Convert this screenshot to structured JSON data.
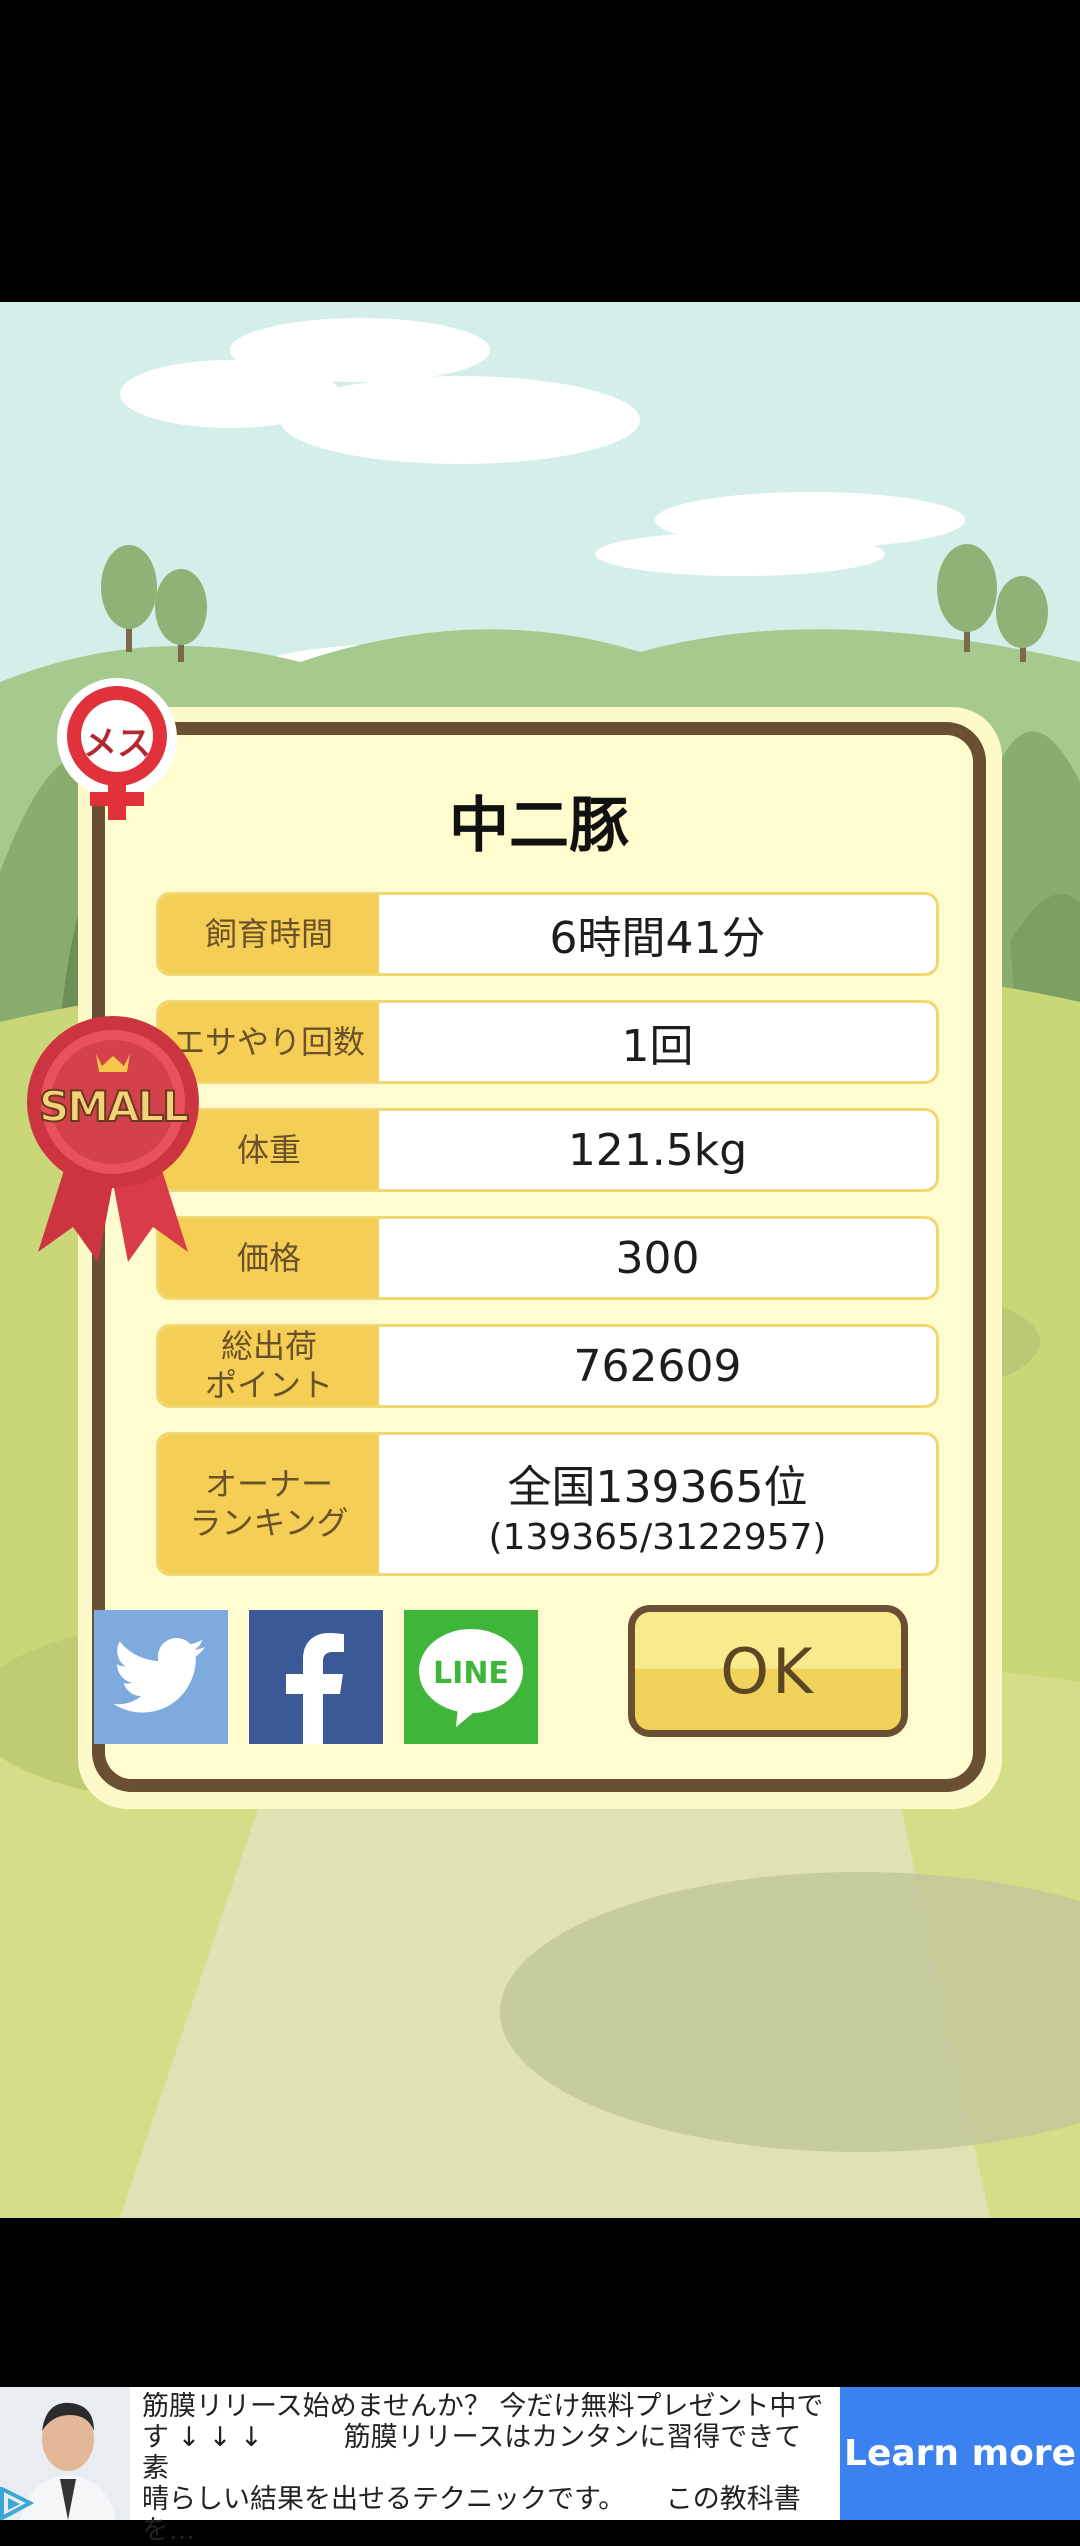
{
  "pig": {
    "name": "中二豚",
    "gender_badge": "メス",
    "size_badge": "SMALL"
  },
  "stats": [
    {
      "label": "飼育時間",
      "value": "6時間41分"
    },
    {
      "label": "エサやり回数",
      "value": "1回"
    },
    {
      "label": "体重",
      "value": "121.5kg"
    },
    {
      "label": "価格",
      "value": "300"
    },
    {
      "label": "総出荷\nポイント",
      "value": "762609"
    }
  ],
  "ranking": {
    "label": "オーナー\nランキング",
    "value": "全国139365位",
    "detail": "(139365/3122957)"
  },
  "share": {
    "twitter_icon": "twitter-bird-icon",
    "facebook_icon": "facebook-f-icon",
    "line_label": "LINE"
  },
  "ok_label": "OK",
  "ad": {
    "text": "筋膜リリース始めませんか？ 今だけ無料プレゼント中で\nす ↓ ↓ ↓　　　筋膜リリースはカンタンに習得できて 素\n晴らしい結果を出せるテクニックです。　　この教科書\nを...",
    "cta": "Learn more"
  },
  "colors": {
    "dialog_border": "#6a4f33",
    "label_bg": "#f5cf55",
    "twitter": "#7eaadd",
    "facebook": "#3b5997",
    "line": "#3fb63a",
    "ad_cta": "#3b82f0"
  }
}
